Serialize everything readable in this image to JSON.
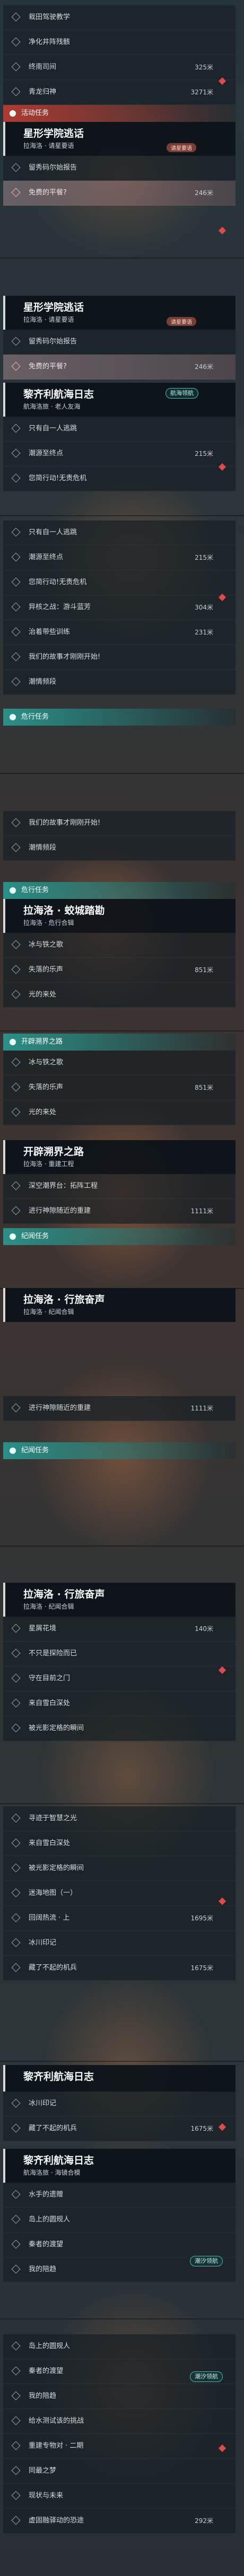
{
  "screen1": {
    "rows_top": [
      {
        "label": "栽田驾驶教学",
        "dist": ""
      },
      {
        "label": "净化井阵残骸",
        "dist": ""
      },
      {
        "label": "终南司间",
        "dist": "325米"
      },
      {
        "label": "青龙归神",
        "dist": "3271米"
      }
    ],
    "category": "活动任务",
    "head": {
      "title": "星形学院逃话",
      "sub": "拉海洛 · 请星要语",
      "tag": "请星要语"
    },
    "rows": [
      {
        "label": "留秀码尔始报告",
        "dist": ""
      },
      {
        "label": "免费的平餐?",
        "dist": "246米"
      }
    ]
  },
  "screen2": {
    "head": {
      "title": "星形学院逃话",
      "sub": "拉海洛 · 请星要语",
      "tag": "请星要语"
    },
    "rows": [
      {
        "label": "留秀码尔始报告",
        "dist": ""
      },
      {
        "label": "免费的平餐?",
        "dist": "246米"
      }
    ],
    "head2": {
      "title": "黎齐利航海日志",
      "sub": "航海洛旅 · 老人友海",
      "badge": "航海领航"
    },
    "rows2": [
      {
        "label": "只有自一人逃跳",
        "dist": ""
      },
      {
        "label": "潮源至终点",
        "dist": "215米"
      },
      {
        "label": "您简行动!无责危机",
        "dist": ""
      }
    ]
  },
  "screen3": {
    "rows": [
      {
        "label": "只有自一人逃跳",
        "dist": ""
      },
      {
        "label": "潮源至终点",
        "dist": "215米"
      },
      {
        "label": "您简行动!无责危机",
        "dist": ""
      },
      {
        "label": "异核之战：游斗蓝芳",
        "dist": "304米"
      },
      {
        "label": "治着带些训练",
        "dist": "231米"
      },
      {
        "label": "我们的故事才刚刚开始!",
        "dist": ""
      },
      {
        "label": "潮情频段",
        "dist": ""
      }
    ],
    "category": "危行任务"
  },
  "screen4": {
    "rows": [
      {
        "label": "我们的故事才刚刚开始!",
        "dist": ""
      },
      {
        "label": "潮情频段",
        "dist": ""
      }
    ],
    "category": "危行任务",
    "head": {
      "title": "拉海洛 · 蛟城踏勘",
      "sub": "拉海洛 · 危行合辑"
    },
    "rows2": [
      {
        "label": "冰与铁之歌",
        "dist": ""
      },
      {
        "label": "失落的乐声",
        "dist": "851米"
      },
      {
        "label": "光的来处",
        "dist": ""
      }
    ]
  },
  "screen5": {
    "category": "开辟溯界之路",
    "rows": [
      {
        "label": "冰与铁之歌",
        "dist": ""
      },
      {
        "label": "失落的乐声",
        "dist": "851米"
      },
      {
        "label": "光的来处",
        "dist": ""
      }
    ],
    "head": {
      "title": "开辟溯界之路",
      "sub": "拉海洛 · 重建工程"
    },
    "rows2": [
      {
        "label": "深空潮界台：拓阵工程",
        "dist": ""
      },
      {
        "label": "进行神隙随近的重建",
        "dist": "1111米"
      }
    ],
    "category2": "纪闻任务"
  },
  "screen6": {
    "head": {
      "title": "拉海洛 · 行旅奋声",
      "sub": "拉海洛 · 纪闻合辑"
    },
    "rows": [
      {
        "label": "进行神隙随近的重建",
        "dist": "1111米"
      }
    ],
    "category": "纪闻任务"
  },
  "screen7": {
    "head": {
      "title": "拉海洛 · 行旅奋声",
      "sub": "拉海洛 · 纪闻合辑"
    },
    "rows": [
      {
        "label": "星屑花境",
        "dist": "140米"
      },
      {
        "label": "不只是探险而已",
        "dist": ""
      },
      {
        "label": "守在目前之门",
        "dist": ""
      },
      {
        "label": "来自雪白深处",
        "dist": ""
      },
      {
        "label": "被光影定格的瞬间",
        "dist": ""
      }
    ]
  },
  "screen8": {
    "rows": [
      {
        "label": "寻迹于智慧之光",
        "dist": ""
      },
      {
        "label": "来自雪白深处",
        "dist": ""
      },
      {
        "label": "被光影定格的瞬间",
        "dist": ""
      },
      {
        "label": "迷海地图（一）",
        "dist": ""
      },
      {
        "label": "回阔热流 · 上",
        "dist": "1695米"
      },
      {
        "label": "冰川印记",
        "dist": ""
      },
      {
        "label": "藏了不起的机兵",
        "dist": "1675米"
      }
    ]
  },
  "screen9": {
    "head": {
      "title": "黎齐利航海日志",
      "sub": ""
    },
    "rows": [
      {
        "label": "冰川印记",
        "dist": ""
      },
      {
        "label": "藏了不起的机兵",
        "dist": "1675米"
      }
    ],
    "head2": {
      "title": "黎齐利航海日志",
      "sub": "航海洛旅 · 海镜合模",
      "badge": "潮汐领航"
    },
    "rows2": [
      {
        "label": "水手的遗赠",
        "dist": ""
      },
      {
        "label": "岛上的圆规人",
        "dist": ""
      },
      {
        "label": "秦者的渡望",
        "dist": ""
      },
      {
        "label": "我的陪趋",
        "dist": ""
      }
    ]
  },
  "screen10": {
    "rows": [
      {
        "label": "岛上的圆规人",
        "dist": ""
      },
      {
        "label": "秦者的渡望",
        "dist": ""
      },
      {
        "label": "我的陪趋",
        "dist": ""
      },
      {
        "label": "给水测试该的挑战",
        "dist": ""
      },
      {
        "label": "重建专物对 · 二期",
        "dist": ""
      },
      {
        "label": "同最之梦",
        "dist": ""
      },
      {
        "label": "现状与未来",
        "dist": ""
      },
      {
        "label": "虚固融驿动的恐途",
        "dist": "292米"
      }
    ],
    "badge": "潮汐领航"
  }
}
